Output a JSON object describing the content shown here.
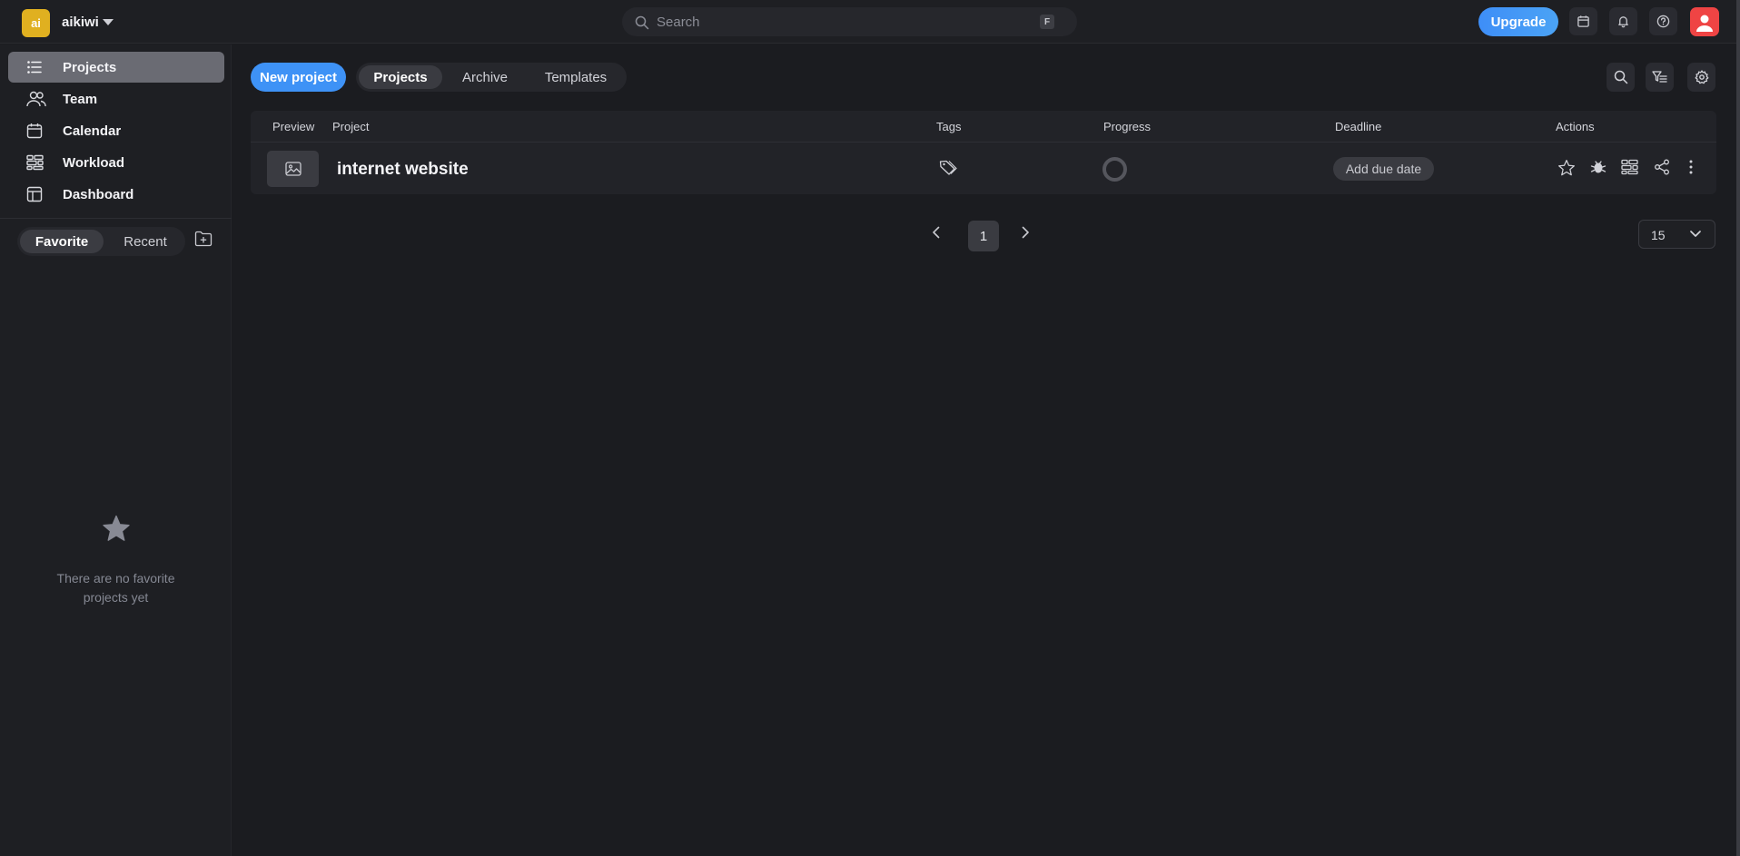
{
  "workspace": {
    "logo_text": "ai",
    "name": "aikiwi",
    "logo_color": "#e0b020"
  },
  "search": {
    "placeholder": "Search",
    "shortcut": "F"
  },
  "header": {
    "upgrade_label": "Upgrade"
  },
  "sidebar": {
    "items": [
      {
        "label": "Projects",
        "icon": "list-icon",
        "active": true
      },
      {
        "label": "Team",
        "icon": "team-icon"
      },
      {
        "label": "Calendar",
        "icon": "calendar-icon"
      },
      {
        "label": "Workload",
        "icon": "workload-icon"
      },
      {
        "label": "Dashboard",
        "icon": "dashboard-icon"
      }
    ],
    "segments": {
      "favorite": "Favorite",
      "recent": "Recent"
    },
    "empty_message": "There are no favorite projects yet"
  },
  "toolbar": {
    "new_project_label": "New project",
    "tabs": [
      {
        "label": "Projects",
        "active": true
      },
      {
        "label": "Archive"
      },
      {
        "label": "Templates"
      }
    ]
  },
  "table": {
    "columns": [
      "Preview",
      "Project",
      "Tags",
      "Progress",
      "Deadline",
      "Actions"
    ],
    "rows": [
      {
        "name": "internet website",
        "deadline_label": "Add due date",
        "progress": 0
      }
    ]
  },
  "pagination": {
    "current_page": "1",
    "per_page": "15"
  },
  "colors": {
    "accent": "#3e92f6",
    "avatar": "#ef4444",
    "background": "#1b1c20"
  }
}
